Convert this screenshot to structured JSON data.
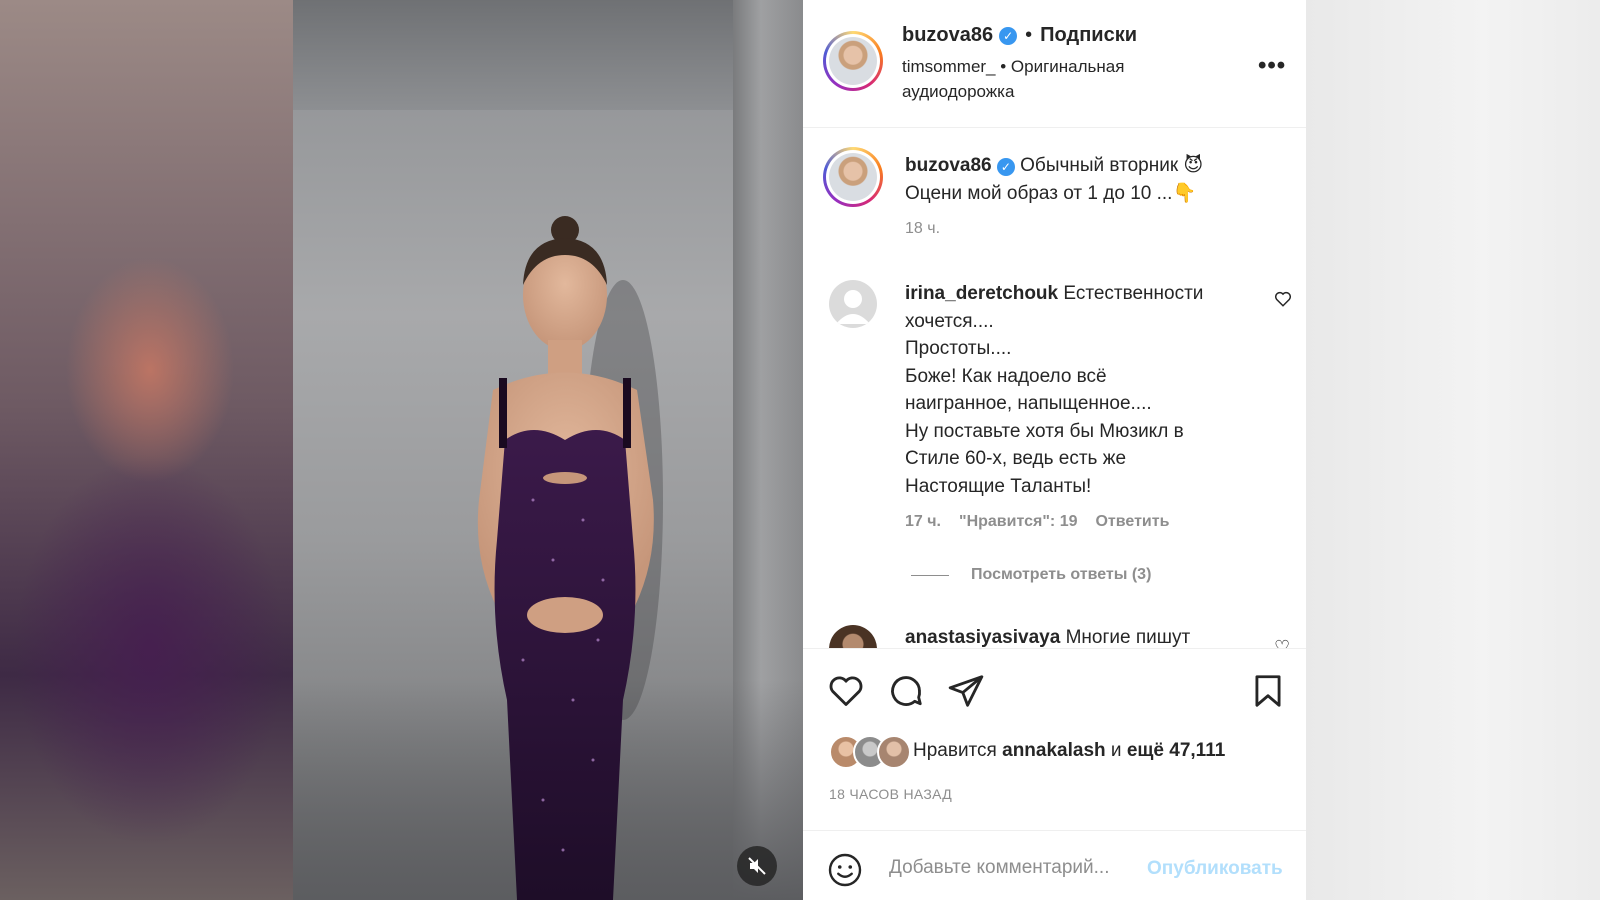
{
  "post": {
    "username": "buzova86",
    "follow_label": "Подписки",
    "audio_line_1": "timsommer_ • Оригинальная",
    "audio_line_2": "аудиодорожка",
    "more_label": "•••"
  },
  "caption": {
    "username": "buzova86",
    "line1": "Обычный вторник",
    "line1_emoji": "😈",
    "line2": "Оцени мой образ от 1 до 10 ...",
    "line2_emoji": "👇",
    "time": "18 ч."
  },
  "comments": [
    {
      "username": "irina_deretchouk",
      "text_first": "Естественности",
      "lines": [
        "хочется....",
        "Простоты....",
        "Боже! Как надоело всё",
        "наигранное, напыщенное....",
        "Ну поставьте хотя бы Мюзикл в",
        "Стиле 60-х, ведь есть же",
        "Настоящие Таланты!"
      ],
      "time": "17 ч.",
      "likes": "\"Нравится\": 19",
      "reply": "Ответить",
      "view_replies": "Посмотреть ответы (3)"
    },
    {
      "username": "anastasiyasivaya",
      "text": "Многие пишут"
    }
  ],
  "likes": {
    "prefix": "Нравится",
    "user": "annakalash",
    "connector": "и",
    "count": "ещё 47,111"
  },
  "date": "18 ЧАСОВ НАЗАД",
  "add_comment": {
    "placeholder": "Добавьте комментарий...",
    "publish": "Опубликовать"
  },
  "colors": {
    "verified": "#3897f0",
    "publish_disabled": "#b2dffc",
    "secondary_text": "#8e8e8e",
    "primary_text": "#262626"
  }
}
